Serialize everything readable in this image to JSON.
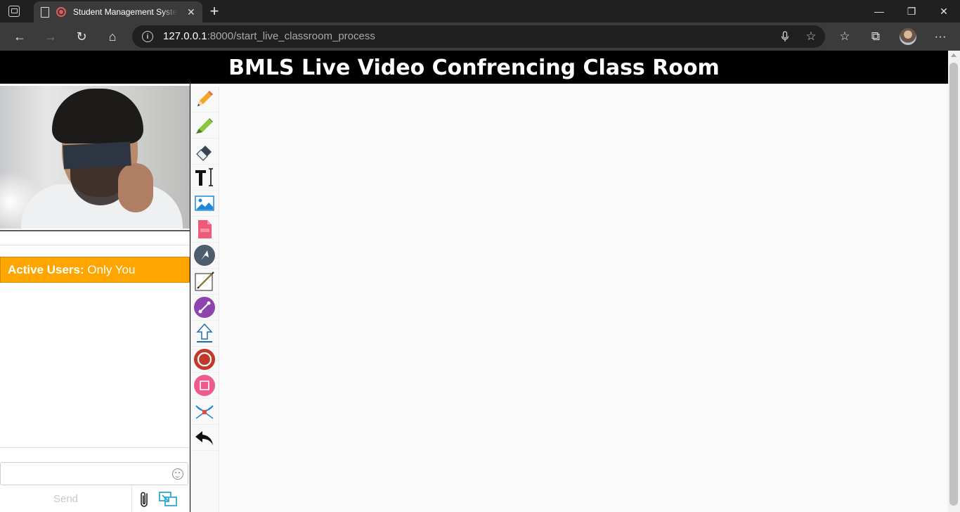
{
  "browser": {
    "tab_title": "Student Management System",
    "new_tab": "+",
    "url_host": "127.0.0.1",
    "url_rest": ":8000/start_live_classroom_process",
    "window_controls": {
      "minimize": "—",
      "restore": "❐",
      "close": "✕"
    },
    "nav_icons": {
      "back": "←",
      "forward": "→",
      "refresh": "↻",
      "home": "⌂",
      "info": "i",
      "mic": "🎙",
      "fav_add": "☆",
      "favorites": "☆",
      "collections": "⧉",
      "more": "···"
    }
  },
  "page": {
    "header_title": "BMLS Live Video Confrencing Class Room",
    "active_users_label": "Active Users:",
    "active_users_value": " Only You",
    "chat_placeholder": "",
    "send_label": "Send"
  },
  "tools": [
    "pencil-icon",
    "marker-icon",
    "eraser-icon",
    "text-icon",
    "image-icon",
    "pdf-icon",
    "arrow-icon",
    "line-icon",
    "connector-icon",
    "upload-icon",
    "circle-icon",
    "rectangle-icon",
    "bezier-icon",
    "undo-icon"
  ]
}
